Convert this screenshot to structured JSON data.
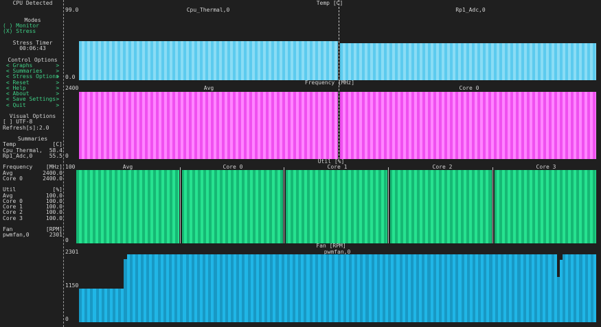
{
  "sidebar": {
    "rows": [
      {
        "row": 0,
        "left": "CPU Detected",
        "center": true
      },
      {
        "row": 3,
        "left": "Modes",
        "center": true
      },
      {
        "row": 4,
        "left": "( ) Monitor",
        "green": true
      },
      {
        "row": 5,
        "left": "(X) Stress",
        "green": true
      },
      {
        "row": 7,
        "left": "Stress Timer",
        "center": true
      },
      {
        "row": 8,
        "left": "00:06:43",
        "center": true
      },
      {
        "row": 10,
        "left": "Control Options",
        "center": true
      },
      {
        "row": 11,
        "left": " < Graphs",
        "right": "> ",
        "green": true,
        "interactable": true
      },
      {
        "row": 12,
        "left": " < Summaries",
        "right": "> ",
        "green": true,
        "interactable": true
      },
      {
        "row": 13,
        "left": " < Stress Options",
        "right": "> ",
        "green": true,
        "interactable": true
      },
      {
        "row": 14,
        "left": " < Reset",
        "right": "> ",
        "green": true,
        "interactable": true
      },
      {
        "row": 15,
        "left": " < Help",
        "right": "> ",
        "green": true,
        "interactable": true
      },
      {
        "row": 16,
        "left": " < About",
        "right": "> ",
        "green": true,
        "interactable": true
      },
      {
        "row": 17,
        "left": " < Save Settings",
        "right": "> ",
        "green": true,
        "interactable": true
      },
      {
        "row": 18,
        "left": " < Quit",
        "right": "> ",
        "green": true,
        "interactable": true
      },
      {
        "row": 20,
        "left": "Visual Options",
        "center": true
      },
      {
        "row": 21,
        "left": "[ ] UTF-8",
        "interactable": true
      },
      {
        "row": 22,
        "left": "Refresh[s]:2.0",
        "interactable": true
      },
      {
        "row": 24,
        "left": "Summaries",
        "center": true
      },
      {
        "row": 25,
        "left": "Temp",
        "right": "[C]"
      },
      {
        "row": 26,
        "left": "Cpu_Thermal,",
        "right": "58.4"
      },
      {
        "row": 27,
        "left": "Rp1_Adc,0",
        "right": "55.5"
      },
      {
        "row": 29,
        "left": "Frequency",
        "right": "[MHz]"
      },
      {
        "row": 30,
        "left": "Avg",
        "right": "2400.0"
      },
      {
        "row": 31,
        "left": "Core 0",
        "right": "2400.0"
      },
      {
        "row": 33,
        "left": "Util",
        "right": "[%]"
      },
      {
        "row": 34,
        "left": "Avg",
        "right": "100.0"
      },
      {
        "row": 35,
        "left": "Core 0",
        "right": "100.0"
      },
      {
        "row": 36,
        "left": "Core 1",
        "right": "100.0"
      },
      {
        "row": 37,
        "left": "Core 2",
        "right": "100.0"
      },
      {
        "row": 38,
        "left": "Core 3",
        "right": "100.0"
      },
      {
        "row": 40,
        "left": "Fan",
        "right": "[RPM]"
      },
      {
        "row": 41,
        "left": "pwmfan,0",
        "right": "2301"
      }
    ]
  },
  "chart_data": [
    {
      "type": "bar",
      "title": "Temp [C]",
      "y_top_label": "99.0",
      "y_bottom_label": "0.0",
      "ylim": [
        0,
        99.0
      ],
      "series": [
        {
          "name": "Cpu_Thermal,0",
          "value": 58.4
        },
        {
          "name": "Rp1_Adc,0",
          "value": 55.5
        }
      ],
      "color": "#5ccbee",
      "color_alt": "#8adcf5"
    },
    {
      "type": "bar",
      "title": "Frequency [MHz]",
      "y_top_label": "2400",
      "y_bottom_label": "0",
      "ylim": [
        0,
        2400
      ],
      "series": [
        {
          "name": "Avg",
          "value": 2400.0
        },
        {
          "name": "Core 0",
          "value": 2400.0
        }
      ],
      "color": "#f050f0",
      "color_alt": "#ff85ff"
    },
    {
      "type": "bar",
      "title": "Util [%]",
      "y_top_label": "100",
      "y_bottom_label": "0",
      "ylim": [
        0,
        100
      ],
      "series": [
        {
          "name": "Avg",
          "value": 100.0
        },
        {
          "name": "Core 0",
          "value": 100.0
        },
        {
          "name": "Core 1",
          "value": 100.0
        },
        {
          "name": "Core 2",
          "value": 100.0
        },
        {
          "name": "Core 3",
          "value": 100.0
        }
      ],
      "color": "#16b874",
      "color_alt": "#26e290"
    },
    {
      "type": "bar",
      "title": "Fan [RPM]",
      "y_top_label": "2301",
      "y_mid_label": "1150",
      "y_bottom_label": "0",
      "ylim": [
        0,
        2301
      ],
      "series": [
        {
          "name": "pwmfan,0",
          "runs": [
            [
              16,
              1150
            ],
            [
              1,
              2140
            ],
            [
              153,
              2301
            ],
            [
              1,
              1530
            ],
            [
              1,
              2120
            ],
            [
              12,
              2301
            ]
          ]
        }
      ],
      "color": "#1898c4",
      "color_alt": "#20b6e6"
    }
  ]
}
